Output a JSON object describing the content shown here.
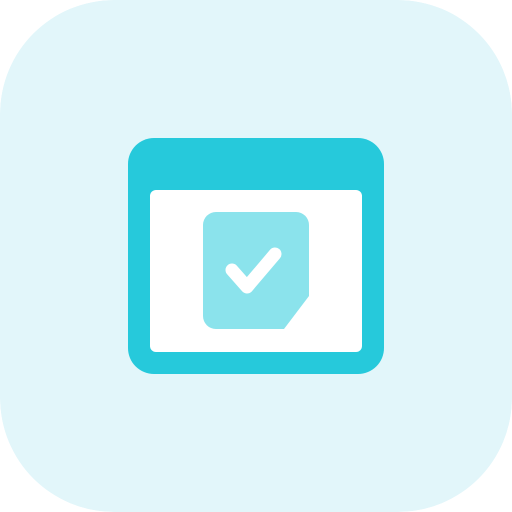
{
  "icon": {
    "name": "browser-window-task-checked-icon",
    "colors": {
      "background": "#E2F6FA",
      "accent": "#26C9DB",
      "inner_background": "#FFFFFF",
      "document": "#8BE3EC",
      "checkmark": "#FFFFFF"
    }
  }
}
